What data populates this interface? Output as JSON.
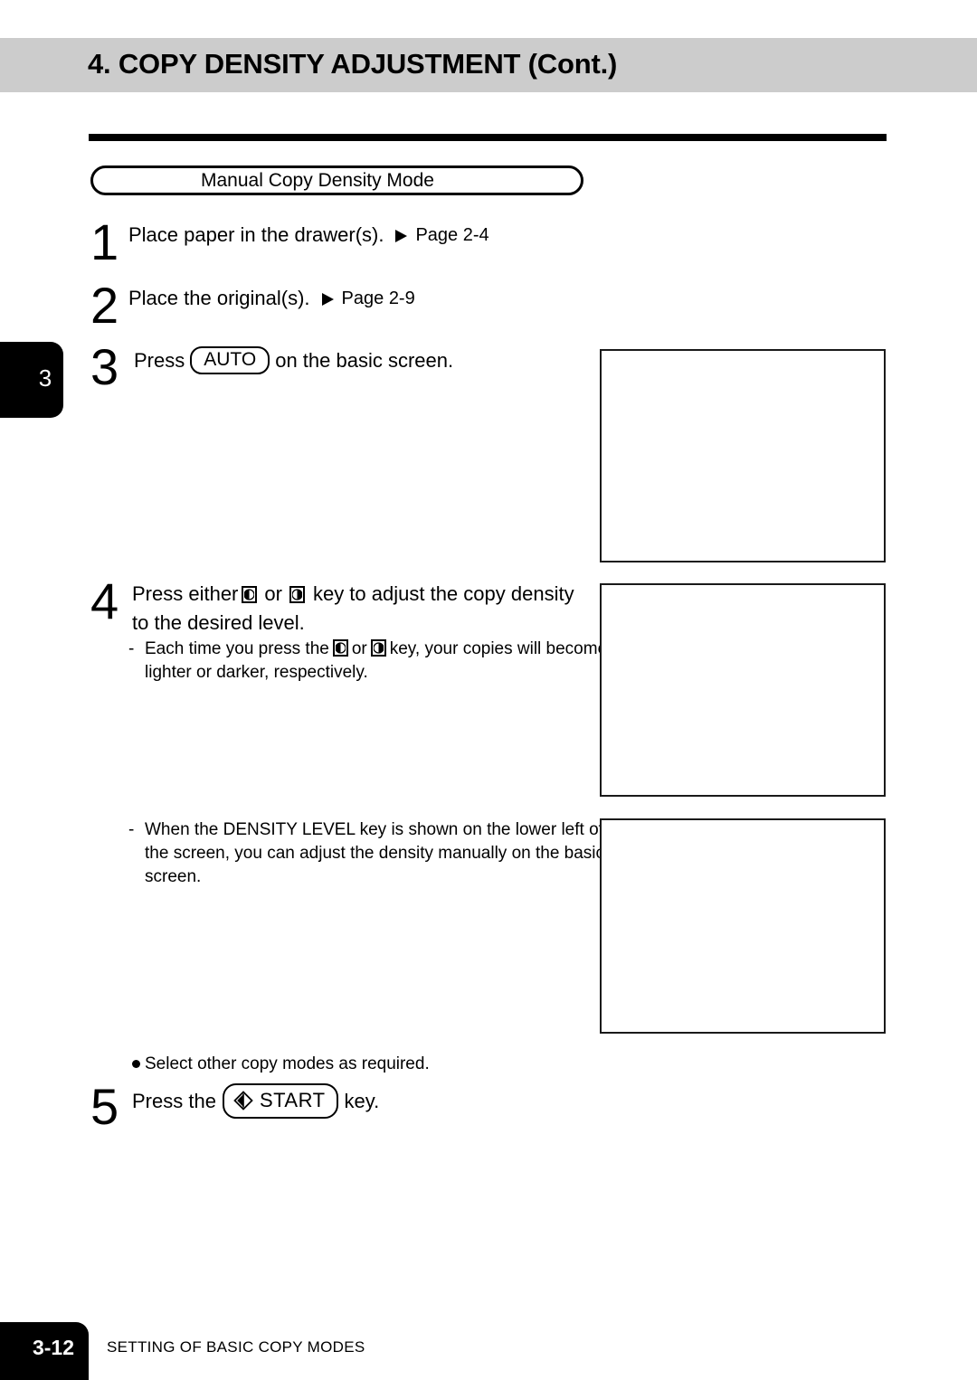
{
  "header": {
    "title": "4. COPY DENSITY ADJUSTMENT (Cont.)",
    "band_color": "#cccccc"
  },
  "section": {
    "pill_label": "Manual Copy Density Mode"
  },
  "side_tab": {
    "chapter": "3"
  },
  "steps": [
    {
      "number": "1",
      "text": "Place paper in the drawer(s).",
      "page_ref": "Page 2-4"
    },
    {
      "number": "2",
      "text": "Place the original(s).",
      "page_ref": "Page 2-9"
    },
    {
      "number": "3",
      "text_before": "Press",
      "key_label": "AUTO",
      "text_after": "on the basic screen."
    },
    {
      "number": "4",
      "text_before": "Press either",
      "text_mid": "or",
      "text_after": "key to adjust the copy density",
      "line2": "to the desired level."
    },
    {
      "number": "5",
      "text_before": "Press the",
      "key_label": "START",
      "text_after": "key."
    }
  ],
  "notes": [
    {
      "dash": "-",
      "part1": "Each time you press the",
      "part2": "or",
      "part3": "key, your copies will become",
      "line2": "lighter or darker, respectively."
    },
    {
      "dash": "-",
      "line1": "When the DENSITY LEVEL key is shown on the lower left of",
      "line2": "the screen, you can adjust the density manually on the basic",
      "line3": "screen."
    }
  ],
  "bullet_note": {
    "text": "Select other copy modes as required."
  },
  "illustration_boxes": [
    {
      "label": "basic-screen-auto-density"
    },
    {
      "label": "density-adjust-keys-screen"
    },
    {
      "label": "density-level-key-screen"
    }
  ],
  "footer": {
    "page_number": "3-12",
    "section_text": "SETTING OF BASIC COPY MODES"
  }
}
